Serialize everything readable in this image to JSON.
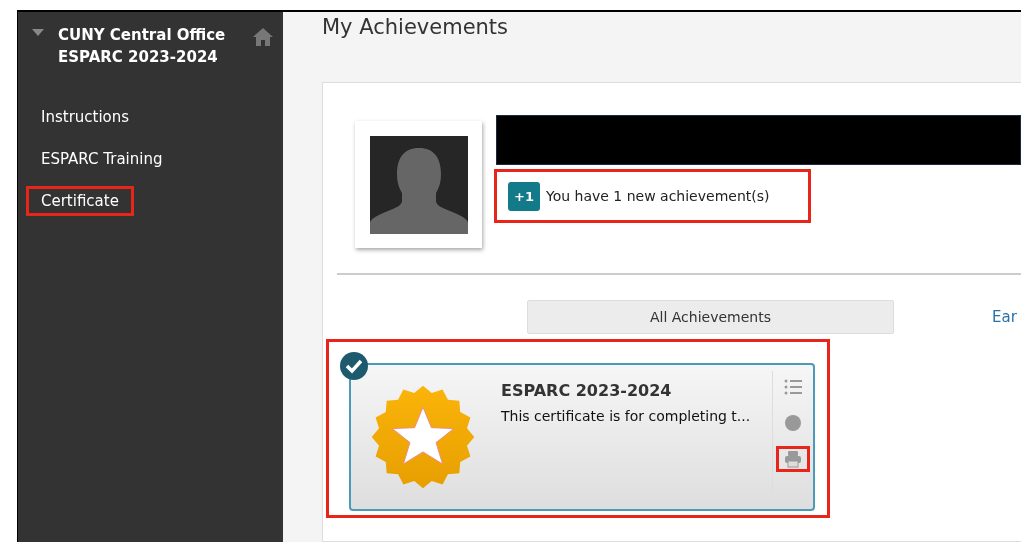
{
  "sidebar": {
    "course_title": "CUNY Central Office ESPARC 2023-2024",
    "expanded": true,
    "items": [
      {
        "label": "Instructions",
        "highlighted": false
      },
      {
        "label": "ESPARC Training",
        "highlighted": false
      },
      {
        "label": "Certificate",
        "highlighted": true
      }
    ]
  },
  "page_title": "My Achievements",
  "profile": {
    "name_redacted": true,
    "notification": {
      "badge": "+1",
      "text": "You have 1 new achievement(s)",
      "highlighted": true
    }
  },
  "filter_button": "All Achievements",
  "link_cut": "Ear",
  "achievement": {
    "title": "ESPARC 2023-2024",
    "description": "This certificate is for completing t...",
    "earned": true,
    "highlighted": true,
    "actions": [
      {
        "kind": "details",
        "highlighted": false
      },
      {
        "kind": "badge",
        "highlighted": false
      },
      {
        "kind": "print",
        "highlighted": true
      }
    ]
  }
}
